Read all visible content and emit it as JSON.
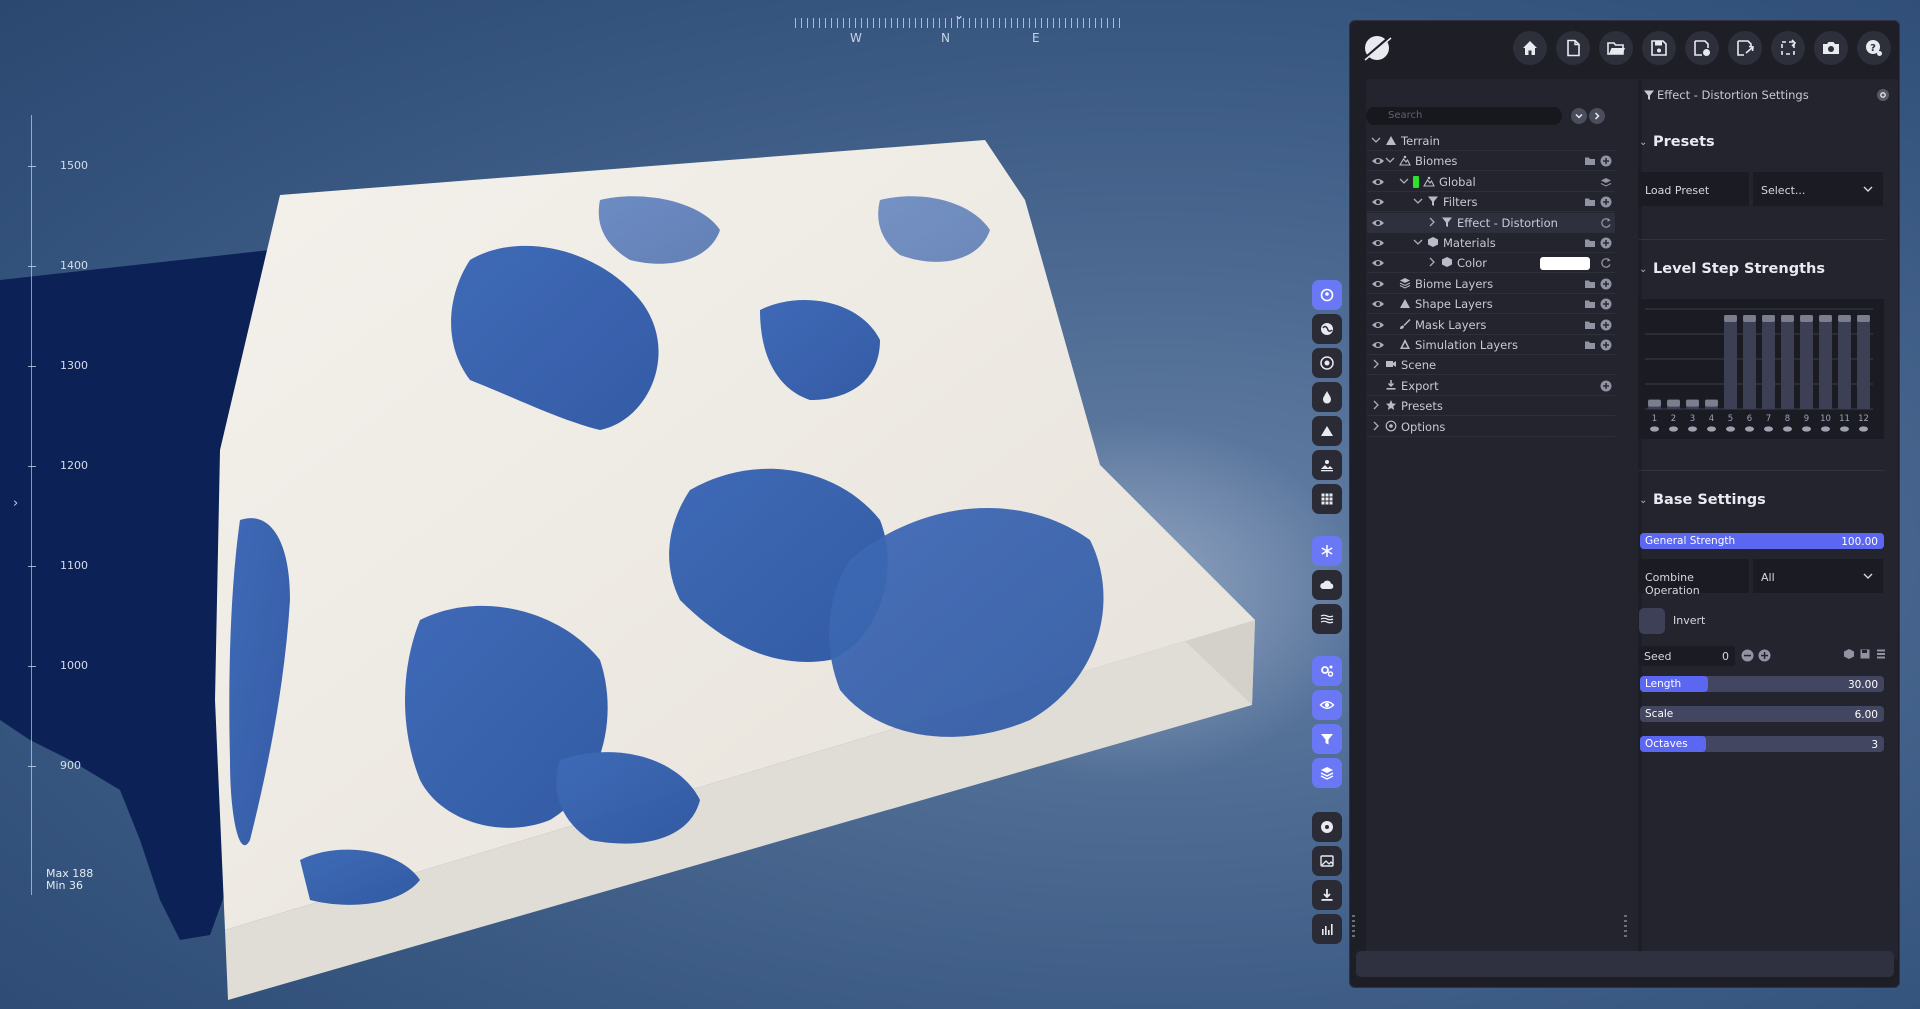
{
  "compass": {
    "needle": "⌄",
    "labels": [
      "W",
      "N",
      "E"
    ]
  },
  "ruler": {
    "labels": [
      "1500",
      "1400",
      "1300",
      "1200",
      "1100",
      "1000",
      "900"
    ],
    "max_label": "Max 188",
    "min_label": "Min 36"
  },
  "viewport_toolbar": {
    "groups": [
      [
        "planet-icon",
        "globe-icon",
        "target-icon",
        "droplet-icon",
        "mountain-icon",
        "landscape-icon",
        "grid-icon"
      ],
      [
        "snowflake-icon",
        "cloud-icon",
        "waves-icon"
      ],
      [
        "settings-nodes-icon",
        "eye-icon",
        "filter-icon",
        "layers-icon"
      ],
      [
        "disc-icon",
        "image-icon",
        "download-icon",
        "chart-icon"
      ]
    ]
  },
  "header": {
    "buttons": [
      "home-icon",
      "new-file-icon",
      "open-folder-icon",
      "save-icon",
      "save-as-icon",
      "export-file-icon",
      "reload-icon",
      "camera-icon",
      "help-icon"
    ]
  },
  "tree": {
    "search_placeholder": "Search",
    "rows": [
      {
        "label": "Terrain",
        "icon": "mountain-icon",
        "indent": 0,
        "eye": false,
        "caret": "down"
      },
      {
        "label": "Biomes",
        "icon": "biome-icon",
        "indent": 1,
        "eye": true,
        "caret": "down",
        "actions": [
          "folder",
          "add"
        ]
      },
      {
        "label": "Global",
        "icon": "biome-icon",
        "indent": 2,
        "eye": true,
        "caret": "down",
        "green": true,
        "actions": [
          "",
          "layers"
        ]
      },
      {
        "label": "Filters",
        "icon": "filter-icon",
        "indent": 3,
        "eye": true,
        "caret": "down",
        "actions": [
          "folder",
          "add"
        ]
      },
      {
        "label": "Effect - Distortion",
        "icon": "filter-icon",
        "indent": 4,
        "eye": true,
        "caret": "right",
        "selected": true,
        "actions": [
          "",
          "sync"
        ]
      },
      {
        "label": "Materials",
        "icon": "cube-icon",
        "indent": 3,
        "eye": true,
        "caret": "down",
        "actions": [
          "folder",
          "add"
        ]
      },
      {
        "label": "Color",
        "icon": "cube-icon",
        "indent": 4,
        "eye": true,
        "caret": "right",
        "swatch": "#ffffff",
        "actions": [
          "",
          "sync"
        ]
      },
      {
        "label": "Biome Layers",
        "icon": "layers-icon",
        "indent": 1,
        "eye": true,
        "caret": "none",
        "actions": [
          "folder",
          "add"
        ]
      },
      {
        "label": "Shape Layers",
        "icon": "mountain-icon",
        "indent": 1,
        "eye": true,
        "caret": "none",
        "actions": [
          "folder",
          "add"
        ]
      },
      {
        "label": "Mask Layers",
        "icon": "brush-icon",
        "indent": 1,
        "eye": true,
        "caret": "none",
        "actions": [
          "folder",
          "add"
        ]
      },
      {
        "label": "Simulation Layers",
        "icon": "sim-icon",
        "indent": 1,
        "eye": true,
        "caret": "none",
        "actions": [
          "folder",
          "add"
        ]
      },
      {
        "label": "Scene",
        "icon": "camera-icon",
        "indent": 0,
        "eye": false,
        "caret": "right"
      },
      {
        "label": "Export",
        "icon": "download-icon",
        "indent": 0,
        "eye": false,
        "caret": "none",
        "actions": [
          "",
          "add"
        ]
      },
      {
        "label": "Presets",
        "icon": "star-icon",
        "indent": 0,
        "eye": false,
        "caret": "right"
      },
      {
        "label": "Options",
        "icon": "gear-icon",
        "indent": 0,
        "eye": false,
        "caret": "right"
      }
    ]
  },
  "settings": {
    "title": "Effect - Distortion Settings",
    "presets": {
      "heading": "Presets",
      "load_label": "Load Preset",
      "select_value": "Select..."
    },
    "level_steps": {
      "heading": "Level Step Strengths"
    },
    "base": {
      "heading": "Base Settings",
      "general_strength": {
        "label": "General Strength",
        "value": "100.00",
        "fill": 1.0
      },
      "combine": {
        "label": "Combine Operation",
        "value": "All"
      },
      "invert_label": "Invert",
      "seed": {
        "label": "Seed",
        "value": "0"
      },
      "length": {
        "label": "Length",
        "value": "30.00",
        "fill": 0.28
      },
      "scale": {
        "label": "Scale",
        "value": "6.00",
        "fill": 0.0
      },
      "octaves": {
        "label": "Octaves",
        "value": "3",
        "fill": 0.27
      }
    }
  },
  "chart_data": {
    "type": "bar",
    "categories": [
      "1",
      "2",
      "3",
      "4",
      "5",
      "6",
      "7",
      "8",
      "9",
      "10",
      "11",
      "12"
    ],
    "values": [
      0.1,
      0.1,
      0.1,
      0.1,
      1,
      1,
      1,
      1,
      1,
      1,
      1,
      1
    ],
    "ylim": [
      0,
      1
    ],
    "grid": true
  },
  "colors": {
    "accent": "#5b67f0",
    "panel": "#1e1f26",
    "sub_panel": "#23242d",
    "selected_row": "#2e303d",
    "green_tag": "#2ee12e"
  }
}
